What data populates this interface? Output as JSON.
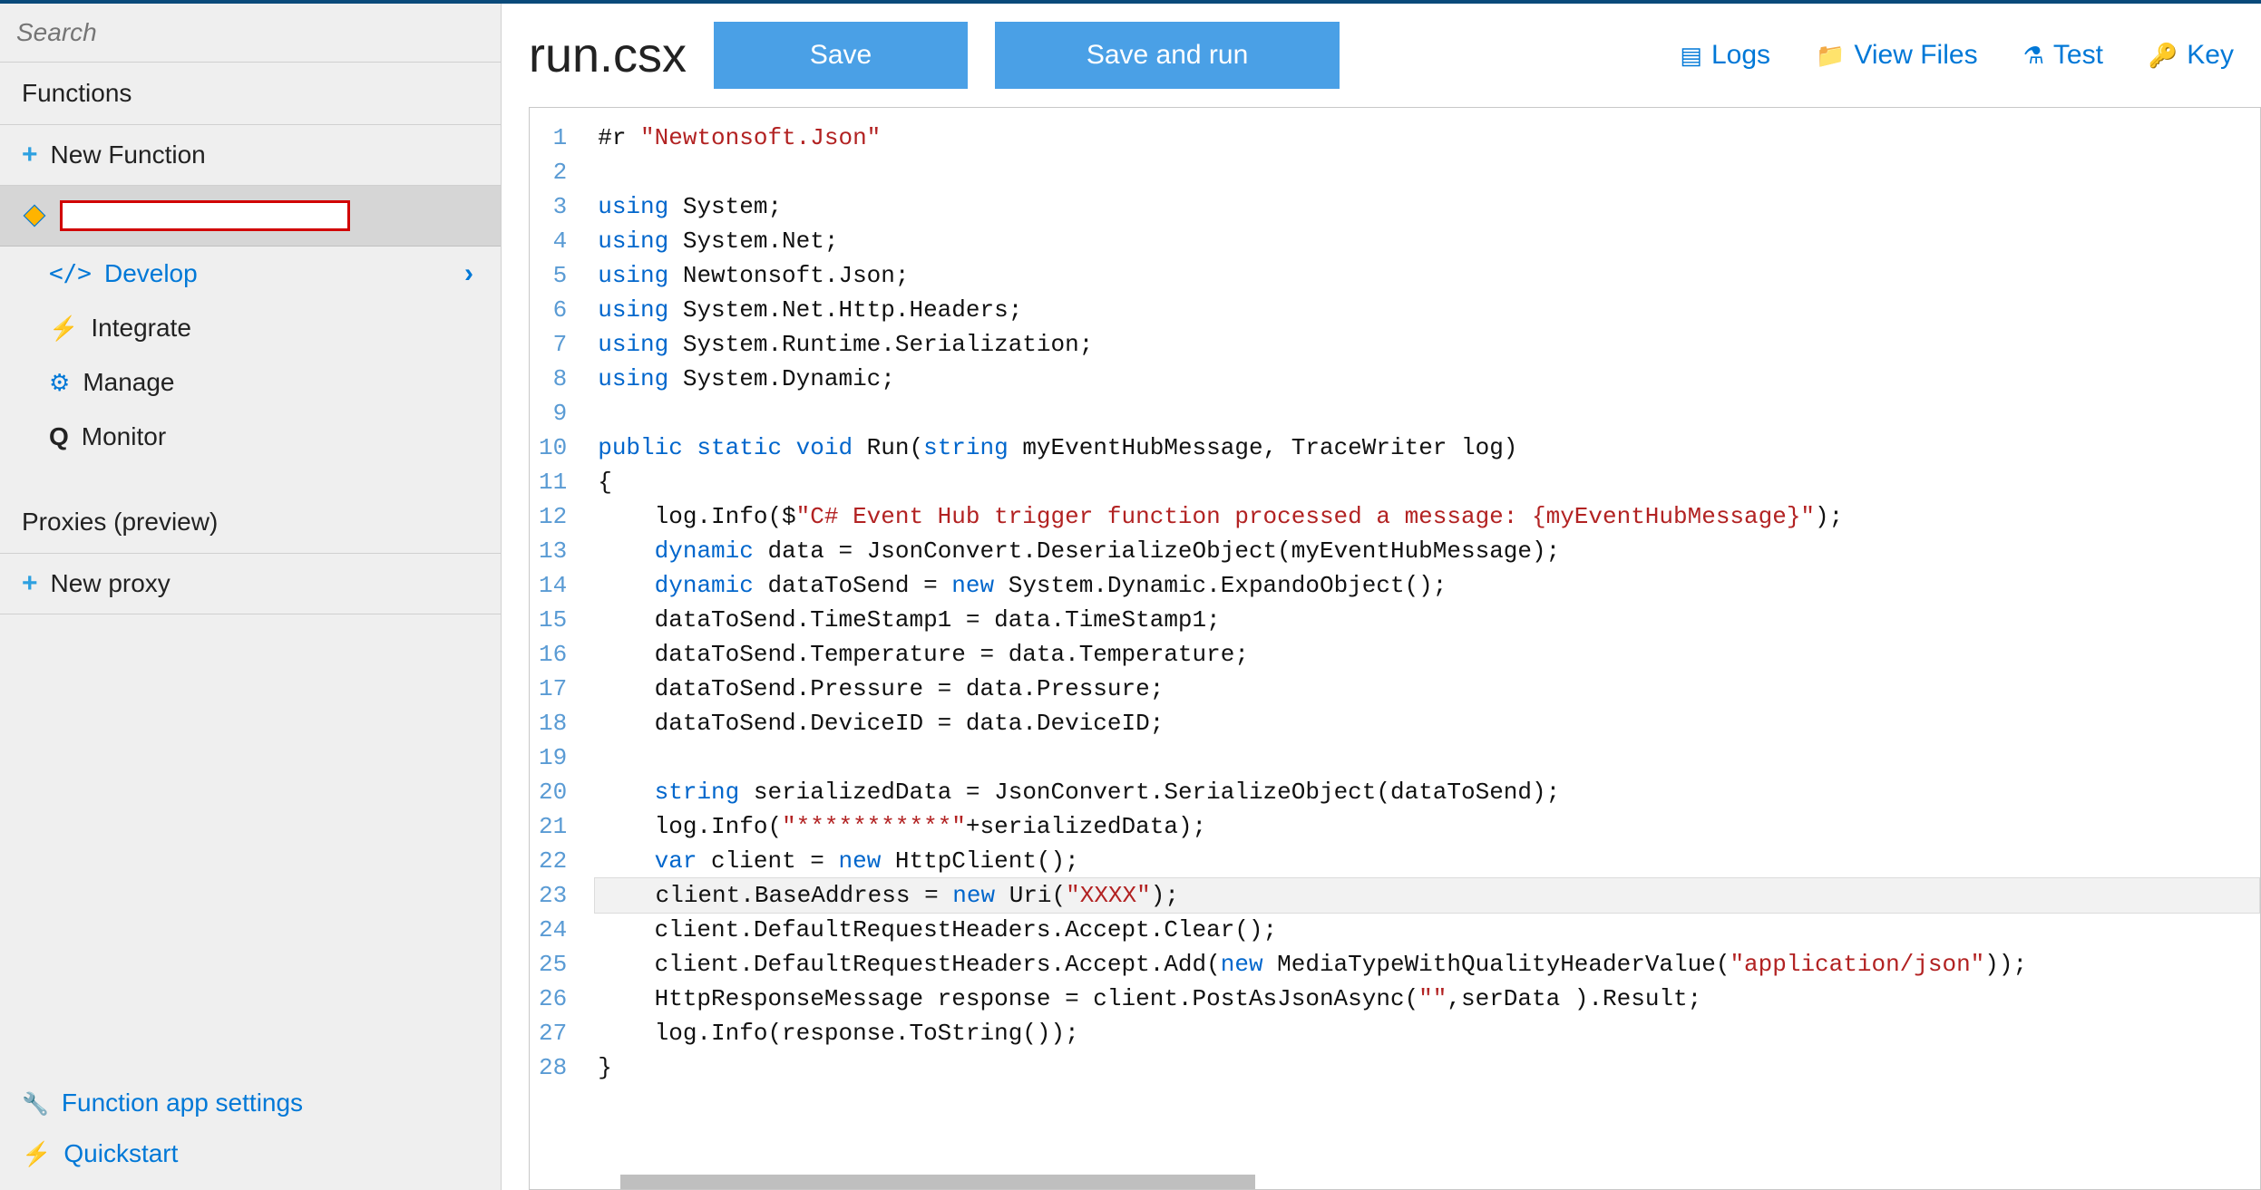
{
  "sidebar": {
    "search_placeholder": "Search",
    "functions_header": "Functions",
    "new_function": "New Function",
    "sub_develop": "Develop",
    "sub_integrate": "Integrate",
    "sub_manage": "Manage",
    "sub_monitor": "Monitor",
    "proxies_header": "Proxies (preview)",
    "new_proxy": "New proxy",
    "footer_settings": "Function app settings",
    "footer_quickstart": "Quickstart"
  },
  "header": {
    "filename": "run.csx",
    "save": "Save",
    "save_run": "Save and run",
    "logs": "Logs",
    "view_files": "View Files",
    "test": "Test",
    "keys": "Key"
  },
  "code": {
    "lines": [
      [
        [
          "",
          "#r "
        ],
        [
          "str",
          "\"Newtonsoft.Json\""
        ]
      ],
      [
        [
          "",
          ""
        ]
      ],
      [
        [
          "kw",
          "using"
        ],
        [
          "",
          " System;"
        ]
      ],
      [
        [
          "kw",
          "using"
        ],
        [
          "",
          " System.Net;"
        ]
      ],
      [
        [
          "kw",
          "using"
        ],
        [
          "",
          " Newtonsoft.Json;"
        ]
      ],
      [
        [
          "kw",
          "using"
        ],
        [
          "",
          " System.Net.Http.Headers;"
        ]
      ],
      [
        [
          "kw",
          "using"
        ],
        [
          "",
          " System.Runtime.Serialization;"
        ]
      ],
      [
        [
          "kw",
          "using"
        ],
        [
          "",
          " System.Dynamic;"
        ]
      ],
      [
        [
          "",
          ""
        ]
      ],
      [
        [
          "kw",
          "public static void"
        ],
        [
          "",
          " Run("
        ],
        [
          "kw",
          "string"
        ],
        [
          "",
          " myEventHubMessage, TraceWriter log)"
        ]
      ],
      [
        [
          "",
          "{"
        ]
      ],
      [
        [
          "",
          "    log.Info($"
        ],
        [
          "str",
          "\"C# Event Hub trigger function processed a message: {myEventHubMessage}\""
        ],
        [
          "",
          ");"
        ]
      ],
      [
        [
          "",
          "    "
        ],
        [
          "kw",
          "dynamic"
        ],
        [
          "",
          " data = JsonConvert.DeserializeObject(myEventHubMessage);"
        ]
      ],
      [
        [
          "",
          "    "
        ],
        [
          "kw",
          "dynamic"
        ],
        [
          "",
          " dataToSend = "
        ],
        [
          "kw",
          "new"
        ],
        [
          "",
          " System.Dynamic.ExpandoObject();"
        ]
      ],
      [
        [
          "",
          "    dataToSend.TimeStamp1 = data.TimeStamp1;"
        ]
      ],
      [
        [
          "",
          "    dataToSend.Temperature = data.Temperature;"
        ]
      ],
      [
        [
          "",
          "    dataToSend.Pressure = data.Pressure;"
        ]
      ],
      [
        [
          "",
          "    dataToSend.DeviceID = data.DeviceID;"
        ]
      ],
      [
        [
          "",
          ""
        ]
      ],
      [
        [
          "",
          "    "
        ],
        [
          "kw",
          "string"
        ],
        [
          "",
          " serializedData = JsonConvert.SerializeObject(dataToSend);"
        ]
      ],
      [
        [
          "",
          "    log.Info("
        ],
        [
          "str",
          "\"***********\""
        ],
        [
          "",
          "+serializedData);"
        ]
      ],
      [
        [
          "",
          "    "
        ],
        [
          "kw",
          "var"
        ],
        [
          "",
          " client = "
        ],
        [
          "kw",
          "new"
        ],
        [
          "",
          " HttpClient();"
        ]
      ],
      [
        [
          "",
          "    client.BaseAddress = "
        ],
        [
          "kw",
          "new"
        ],
        [
          "",
          " Uri("
        ],
        [
          "str",
          "\"XXXX\""
        ],
        [
          "",
          ");"
        ]
      ],
      [
        [
          "",
          "    client.DefaultRequestHeaders.Accept.Clear();"
        ]
      ],
      [
        [
          "",
          "    client.DefaultRequestHeaders.Accept.Add("
        ],
        [
          "kw",
          "new"
        ],
        [
          "",
          " MediaTypeWithQualityHeaderValue("
        ],
        [
          "str",
          "\"application/json\""
        ],
        [
          "",
          "));"
        ]
      ],
      [
        [
          "",
          "    HttpResponseMessage response = client.PostAsJsonAsync("
        ],
        [
          "str",
          "\"\""
        ],
        [
          "",
          ",serData ).Result;"
        ]
      ],
      [
        [
          "",
          "    log.Info(response.ToString());"
        ]
      ],
      [
        [
          "",
          "}"
        ]
      ]
    ],
    "cursor_line": 23
  }
}
